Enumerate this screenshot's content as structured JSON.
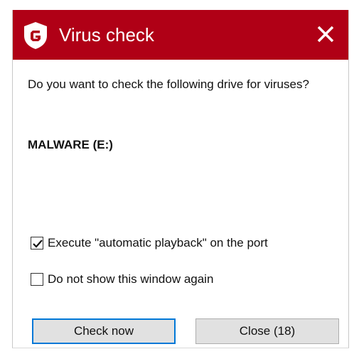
{
  "window": {
    "title": "Virus check",
    "accent_color": "#b00016",
    "logo_icon": "g-data-shield-logo",
    "close_icon": "close-icon"
  },
  "dialog": {
    "question": "Do you want to check the following drive for viruses?",
    "drive_label": "MALWARE (E:)"
  },
  "options": [
    {
      "label": "Execute \"automatic playback\" on the port",
      "checked": true
    },
    {
      "label": "Do not show this window again",
      "checked": false
    }
  ],
  "buttons": {
    "check_now": "Check now",
    "close": "Close (18)"
  }
}
